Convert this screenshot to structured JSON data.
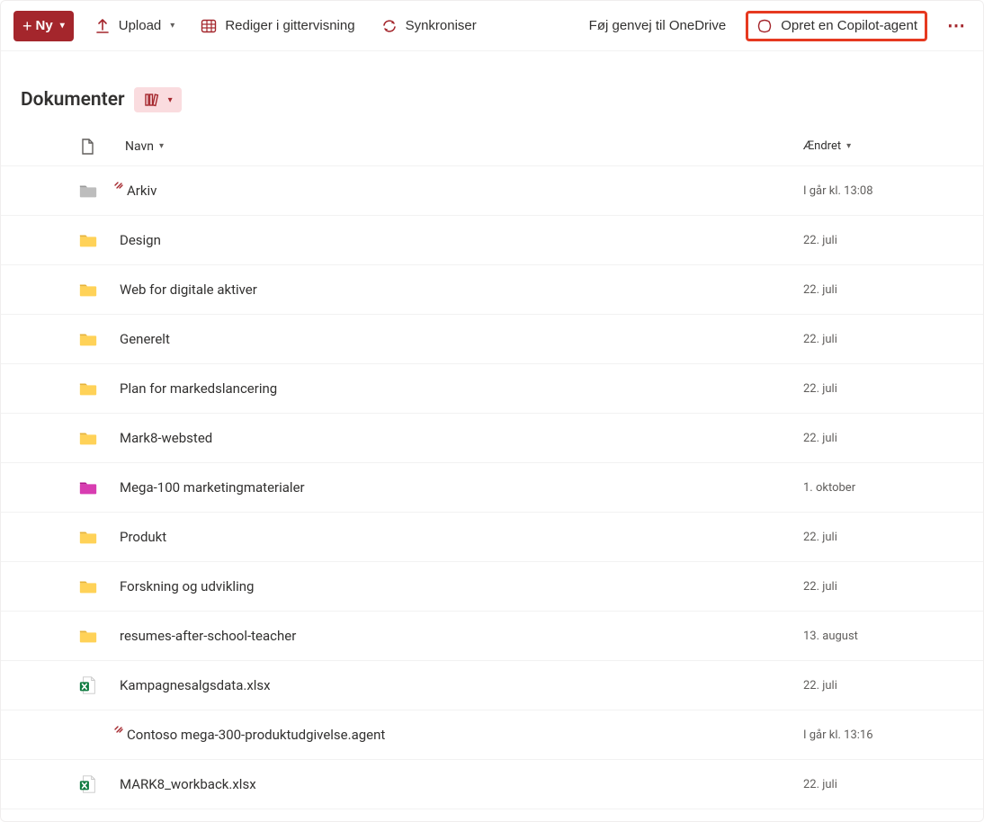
{
  "toolbar": {
    "new_label": "Ny",
    "upload_label": "Upload",
    "edit_grid_label": "Rediger i gittervisning",
    "sync_label": "Synkroniser",
    "add_shortcut_label": "Føj genvej til OneDrive",
    "create_agent_label": "Opret en Copilot-agent"
  },
  "header": {
    "title": "Dokumenter"
  },
  "columns": {
    "name": "Navn",
    "modified": "Ændret"
  },
  "rows": [
    {
      "icon": "folder-gray",
      "new": true,
      "name": "Arkiv",
      "modified": "I går kl. 13:08"
    },
    {
      "icon": "folder-yellow",
      "new": false,
      "name": "Design",
      "modified": "22. juli"
    },
    {
      "icon": "folder-yellow",
      "new": false,
      "name": "Web for digitale aktiver",
      "modified": "22. juli"
    },
    {
      "icon": "folder-yellow",
      "new": false,
      "name": "Generelt",
      "modified": "22. juli"
    },
    {
      "icon": "folder-yellow",
      "new": false,
      "name": "Plan for markedslancering",
      "modified": "22. juli"
    },
    {
      "icon": "folder-yellow",
      "new": false,
      "name": "Mark8-websted",
      "modified": "22. juli"
    },
    {
      "icon": "folder-magenta",
      "new": false,
      "name": "Mega-100 marketingmaterialer",
      "modified": "1. oktober"
    },
    {
      "icon": "folder-yellow",
      "new": false,
      "name": "Produkt",
      "modified": "22. juli"
    },
    {
      "icon": "folder-yellow",
      "new": false,
      "name": "Forskning og udvikling",
      "modified": "22. juli"
    },
    {
      "icon": "folder-yellow",
      "new": false,
      "name": "resumes-after-school-teacher",
      "modified": "13. august"
    },
    {
      "icon": "excel",
      "new": false,
      "name": "Kampagnesalgsdata.xlsx",
      "modified": "22. juli"
    },
    {
      "icon": "copilot",
      "new": true,
      "name": "Contoso mega-300-produktudgivelse.agent",
      "modified": "I går kl. 13:16"
    },
    {
      "icon": "excel",
      "new": false,
      "name": "MARK8_workback.xlsx",
      "modified": "22. juli"
    }
  ],
  "colors": {
    "accent": "#a4262c",
    "highlight_border": "#e63920",
    "folder_yellow_tab": "#e6b33a",
    "folder_yellow_body": "#ffd258",
    "folder_gray_tab": "#9a9a9a",
    "folder_gray_body": "#bdbdbd",
    "folder_magenta_tab": "#b2178b",
    "folder_magenta_body": "#d83db1",
    "excel_green": "#107c41"
  }
}
